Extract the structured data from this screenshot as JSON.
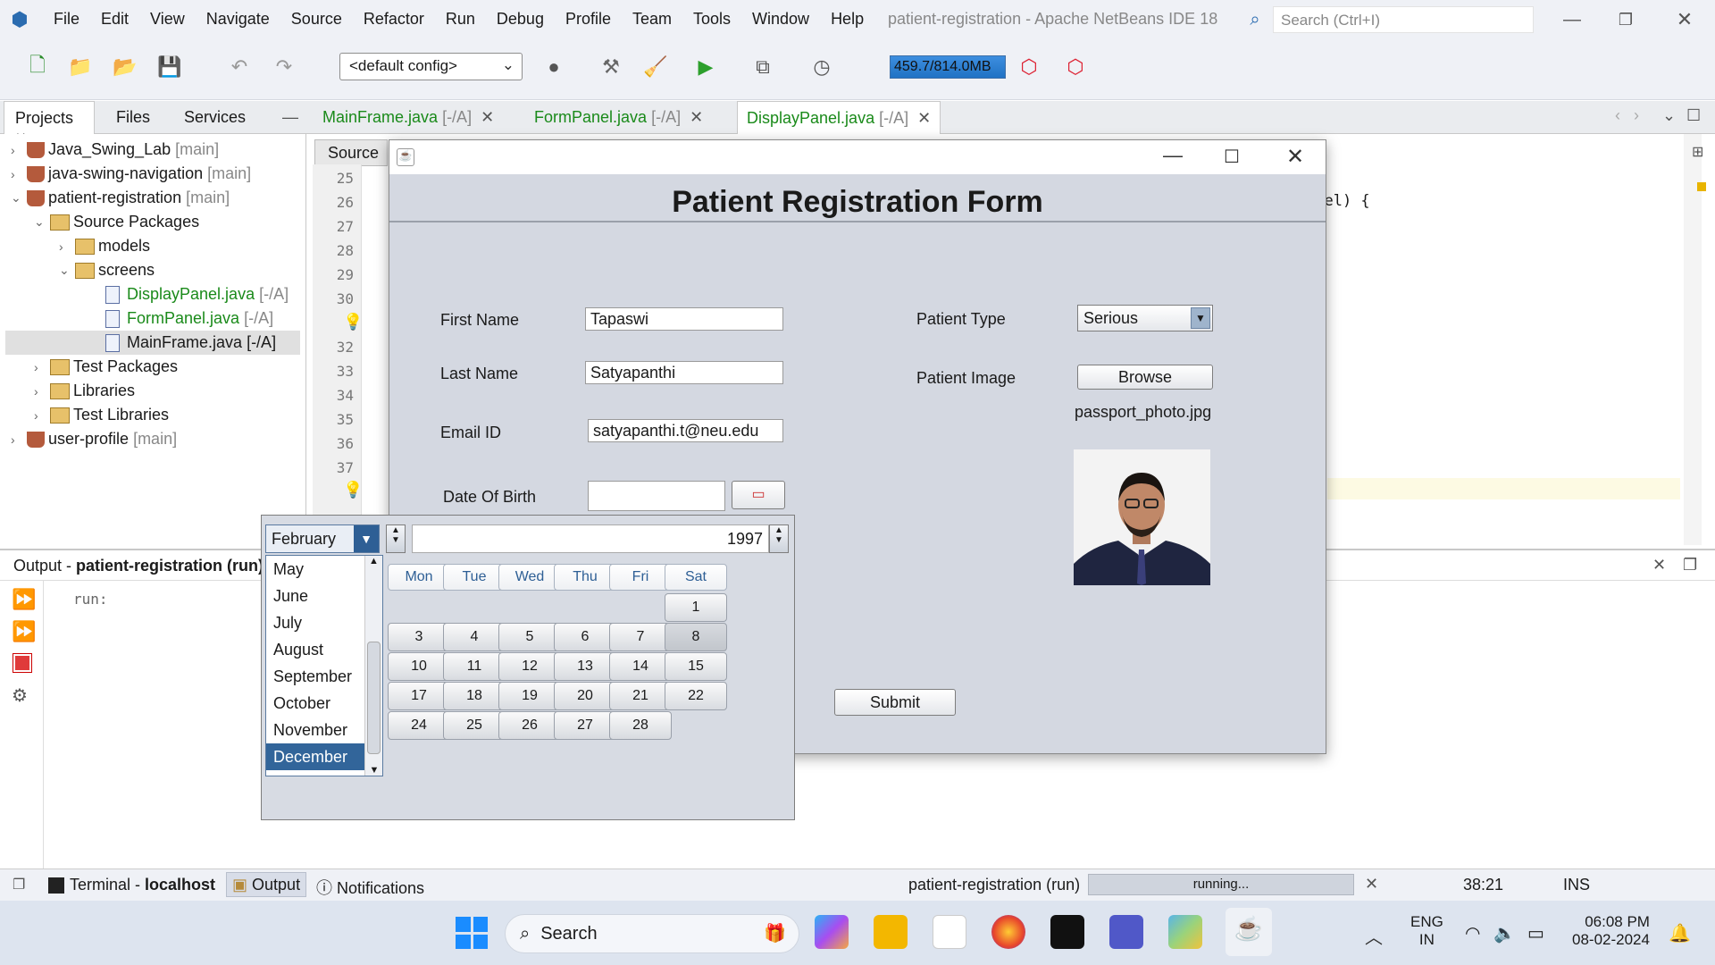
{
  "menu": [
    "File",
    "Edit",
    "View",
    "Navigate",
    "Source",
    "Refactor",
    "Run",
    "Debug",
    "Profile",
    "Team",
    "Tools",
    "Window",
    "Help"
  ],
  "window_title": "patient-registration - Apache NetBeans IDE 18",
  "search_placeholder": "Search (Ctrl+I)",
  "toolbar": {
    "config": "<default config>",
    "memory": "459.7/814.0MB"
  },
  "left_tabs": [
    "Projects",
    "Files",
    "Services"
  ],
  "tree": [
    {
      "label": "Java_Swing_Lab",
      "tag": "[main]"
    },
    {
      "label": "java-swing-navigation",
      "tag": "[main]"
    },
    {
      "label": "patient-registration",
      "tag": "[main]"
    },
    {
      "label": "Source Packages",
      "tag": ""
    },
    {
      "label": "models",
      "tag": ""
    },
    {
      "label": "screens",
      "tag": ""
    },
    {
      "label": "DisplayPanel.java",
      "tag": "[-/A]"
    },
    {
      "label": "FormPanel.java",
      "tag": "[-/A]"
    },
    {
      "label": "MainFrame.java",
      "tag": "[-/A]"
    },
    {
      "label": "Test Packages",
      "tag": ""
    },
    {
      "label": "Libraries",
      "tag": ""
    },
    {
      "label": "Test Libraries",
      "tag": ""
    },
    {
      "label": "user-profile",
      "tag": "[main]"
    }
  ],
  "editor_tabs": [
    {
      "label": "MainFrame.java",
      "tag": "[-/A]"
    },
    {
      "label": "FormPanel.java",
      "tag": "[-/A]"
    },
    {
      "label": "DisplayPanel.java",
      "tag": "[-/A]"
    }
  ],
  "source_btn": "Source",
  "line_numbers": [
    "25",
    "26",
    "27",
    "28",
    "29",
    "30",
    "",
    "32",
    "33",
    "34",
    "35",
    "36",
    "37",
    ""
  ],
  "code_fragment": "abel) {",
  "output": {
    "title_prefix": "Output - ",
    "title_project": "patient-registration (run)",
    "run_text": "run:"
  },
  "status": {
    "terminal": "Terminal - ",
    "terminal_host": "localhost",
    "output": "Output",
    "notifications": "Notifications",
    "task": "patient-registration (run)",
    "progress": "running...",
    "position": "38:21",
    "mode": "INS"
  },
  "form": {
    "title": "Patient Registration Form",
    "first_name_label": "First Name",
    "first_name": "Tapaswi",
    "last_name_label": "Last Name",
    "last_name": "Satyapanthi",
    "email_label": "Email ID",
    "email": "satyapanthi.t@neu.edu",
    "dob_label": "Date Of Birth",
    "patient_type_label": "Patient Type",
    "patient_type": "Serious",
    "patient_image_label": "Patient Image",
    "browse": "Browse",
    "image_file": "passport_photo.jpg",
    "submit": "Submit"
  },
  "calendar": {
    "month": "February",
    "year": "1997",
    "month_options": [
      "May",
      "June",
      "July",
      "August",
      "September",
      "October",
      "November",
      "December"
    ],
    "selected_option": "December",
    "weekdays": [
      "Mon",
      "Tue",
      "Wed",
      "Thu",
      "Fri",
      "Sat"
    ],
    "weeks": [
      [
        "",
        "",
        "",
        "",
        "",
        "1"
      ],
      [
        "3",
        "4",
        "5",
        "6",
        "7",
        "8"
      ],
      [
        "10",
        "11",
        "12",
        "13",
        "14",
        "15"
      ],
      [
        "17",
        "18",
        "19",
        "20",
        "21",
        "22"
      ],
      [
        "24",
        "25",
        "26",
        "27",
        "28",
        ""
      ]
    ],
    "highlight": "8"
  },
  "taskbar": {
    "search": "Search",
    "lang1": "ENG",
    "lang2": "IN",
    "time": "06:08 PM",
    "date": "08-02-2024"
  }
}
